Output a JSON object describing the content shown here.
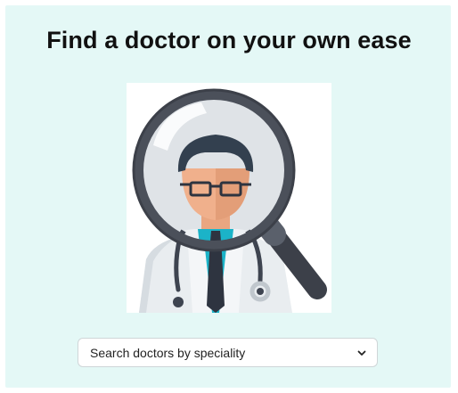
{
  "page": {
    "heading": "Find a doctor on your own ease"
  },
  "illustration": {
    "icon": "doctor-magnifier-icon"
  },
  "search": {
    "selected_label": "Search doctors by speciality",
    "icon": "chevron-down-icon"
  },
  "colors": {
    "panel_background": "#e4f8f6",
    "heading_text": "#111111",
    "coat_teal": "#1bb3c8",
    "lens_frame": "#4b505a"
  }
}
